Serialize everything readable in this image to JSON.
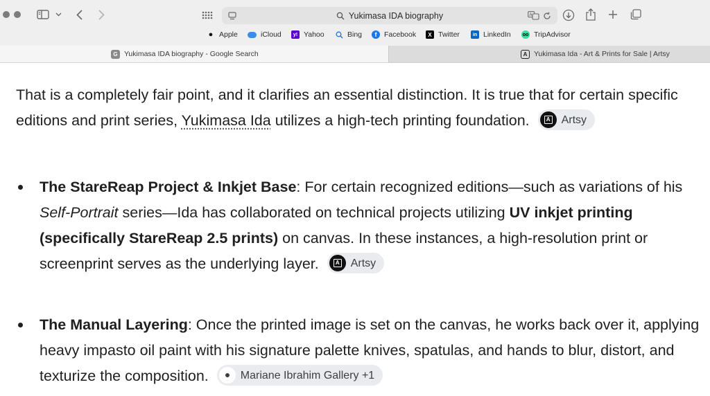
{
  "toolbar": {
    "address_text": "Yukimasa IDA biography"
  },
  "bookmarks": [
    {
      "label": "Apple",
      "icon": "apple-icon"
    },
    {
      "label": "iCloud",
      "icon": "icloud-icon"
    },
    {
      "label": "Yahoo",
      "icon": "yahoo-icon"
    },
    {
      "label": "Bing",
      "icon": "bing-icon"
    },
    {
      "label": "Facebook",
      "icon": "facebook-icon"
    },
    {
      "label": "Twitter",
      "icon": "twitter-x-icon"
    },
    {
      "label": "LinkedIn",
      "icon": "linkedin-icon"
    },
    {
      "label": "TripAdvisor",
      "icon": "tripadvisor-icon"
    }
  ],
  "tabs": [
    {
      "label": "Yukimasa IDA biography - Google Search",
      "favicon": "G",
      "active": true
    },
    {
      "label": "Yukimasa Ida - Art & Prints for Sale | Artsy",
      "favicon": "A",
      "active": false
    }
  ],
  "content": {
    "intro": {
      "part1": "That is a completely fair point, and it clarifies an essential distinction. It is true that for certain specific editions and print series, ",
      "link": "Yukimasa Ida",
      "part2": " utilizes a high-tech printing foundation.",
      "source": "Artsy"
    },
    "bullets": [
      {
        "title": "The StareReap Project & Inkjet Base",
        "t1": ": For certain recognized editions—such as variations of his ",
        "italic": "Self-Portrait",
        "t2": " series—Ida has collaborated on technical projects utilizing ",
        "bold": "UV inkjet printing (specifically StareReap 2.5 prints)",
        "t3": " on canvas. In these instances, a high-resolution print or screenprint serves as the underlying layer.",
        "source": "Artsy"
      },
      {
        "title": "The Manual Layering",
        "t1": ": Once the printed image is set on the canvas, he works back over it, applying heavy impasto oil paint with his signature palette knives, spatulas, and hands to blur, distort, and texturize the composition.",
        "source": "Mariane Ibrahim Gallery +1"
      }
    ]
  },
  "colors": {
    "chrome_bg": "#efefef",
    "chip_bg": "#e9ebee",
    "text": "#1f1f1f"
  }
}
